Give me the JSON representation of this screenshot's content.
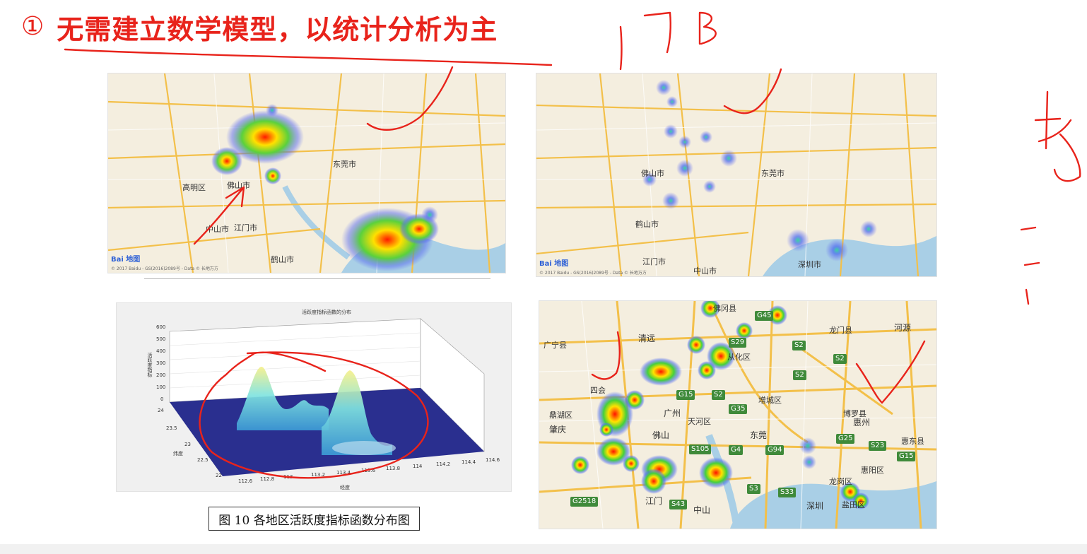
{
  "heading": {
    "number": "①",
    "text": "无需建立数学模型，以统计分析为主"
  },
  "caption": "图 10  各地区活跃度指标函数分布图",
  "plot3d": {
    "title": "活跃度指标函数的分布",
    "xlabel": "经度",
    "ylabel": "纬度",
    "zlabel": "活跃度指标",
    "z_ticks": [
      "600",
      "500",
      "400",
      "300",
      "200",
      "100",
      "0"
    ],
    "y_ticks": [
      "24",
      "23.5",
      "23",
      "22.5",
      "22"
    ],
    "x_ticks": [
      "112.6",
      "112.8",
      "113",
      "113.2",
      "113.4",
      "113.6",
      "113.8",
      "114",
      "114.2",
      "114.4",
      "114.6"
    ]
  },
  "map1": {
    "labels": [
      "东莞市",
      "佛山市",
      "中山市",
      "鹤山市",
      "高明区",
      "江门市"
    ],
    "logo": "Bai 地图",
    "attribution": "© 2017 Baidu - GS(2016)2089号 - Data © 长地万方"
  },
  "map2": {
    "labels": [
      "佛山市",
      "东莞市",
      "鹤山市",
      "中山市",
      "江门市",
      "深圳市"
    ],
    "logo": "Bai 地图",
    "attribution": "© 2017 Baidu - GS(2016)2089号 - Data © 长地万方"
  },
  "map3": {
    "places": [
      "佛冈县",
      "广宁县",
      "清远",
      "四会",
      "广州",
      "天河区",
      "佛山",
      "东莞",
      "增城区",
      "鼎湖区",
      "肇庆",
      "龙门县",
      "河源",
      "博罗县",
      "惠州",
      "惠东县",
      "江门",
      "中山",
      "深圳",
      "惠阳区",
      "龙岗区",
      "盐田区",
      "从化区"
    ],
    "highways": [
      "G45",
      "S29",
      "S2",
      "G15",
      "G35",
      "G4",
      "G94",
      "S105",
      "G25",
      "S23",
      "G15",
      "S3",
      "S33",
      "G2518",
      "S43",
      "S2",
      "S2",
      "S2"
    ]
  },
  "colors": {
    "annotation_red": "#e8231b",
    "map_road": "#f3c04a",
    "water": "#a9cfe6"
  }
}
